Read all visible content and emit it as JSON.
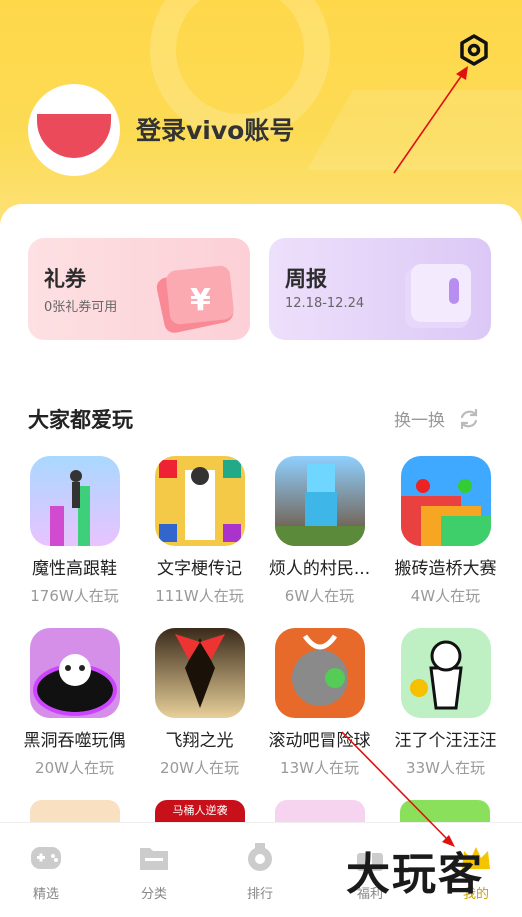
{
  "header": {
    "login_text": "登录vivo账号",
    "settings_icon": "settings-hexagon-icon",
    "bg_color": "#fcd84e"
  },
  "cards": {
    "coupon": {
      "title": "礼券",
      "subtitle": "0张礼券可用",
      "icon": "coupon-yen-icon"
    },
    "weekly": {
      "title": "周报",
      "subtitle": "12.18-12.24",
      "icon": "wallet-icon"
    }
  },
  "section": {
    "title": "大家都爱玩",
    "refresh_label": "换一换",
    "refresh_icon": "refresh-icon"
  },
  "games": [
    {
      "name": "魔性高跟鞋",
      "plays": "176W人在玩"
    },
    {
      "name": "文字梗传记",
      "plays": "111W人在玩"
    },
    {
      "name": "烦人的村民...",
      "plays": "6W人在玩"
    },
    {
      "name": "搬砖造桥大赛",
      "plays": "4W人在玩"
    },
    {
      "name": "黑洞吞噬玩偶",
      "plays": "20W人在玩"
    },
    {
      "name": "飞翔之光",
      "plays": "20W人在玩"
    },
    {
      "name": "滚动吧冒险球",
      "plays": "13W人在玩"
    },
    {
      "name": "汪了个汪汪汪",
      "plays": "33W人在玩"
    }
  ],
  "third_row_banner": "马桶人逆袭",
  "nav": [
    {
      "label": "精选",
      "icon": "gamepad-icon"
    },
    {
      "label": "分类",
      "icon": "folder-icon"
    },
    {
      "label": "排行",
      "icon": "medal-icon"
    },
    {
      "label": "福利",
      "icon": "gift-icon"
    },
    {
      "label": "我的",
      "icon": "crown-icon"
    }
  ],
  "watermark": "大玩客",
  "accent": "#f5c400"
}
